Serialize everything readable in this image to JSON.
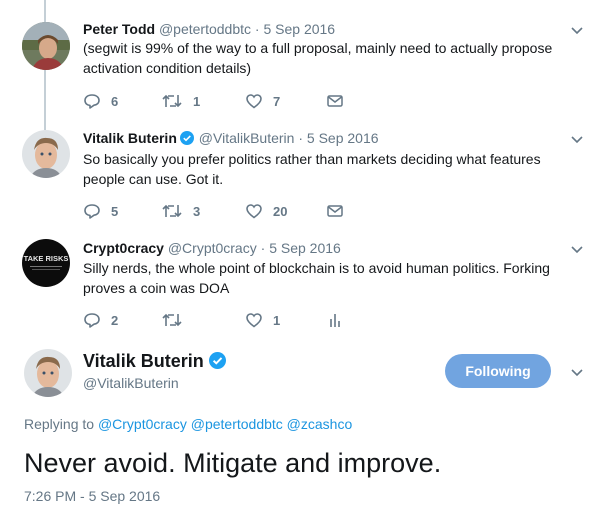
{
  "tweets": [
    {
      "name": "Peter Todd",
      "handle": "@petertoddbtc",
      "sep": " · ",
      "date": "5 Sep 2016",
      "text": "(segwit is 99% of the way to a full proposal, mainly need to actually propose activation condition details)",
      "reply_count": "6",
      "retweet_count": "1",
      "like_count": "7"
    },
    {
      "name": "Vitalik Buterin",
      "handle": "@VitalikButerin",
      "sep": " · ",
      "date": "5 Sep 2016",
      "text": "So basically you prefer politics rather than markets deciding what features people can use. Got it.",
      "reply_count": "5",
      "retweet_count": "3",
      "like_count": "20"
    },
    {
      "name": "Crypt0cracy",
      "handle": "@Crypt0cracy",
      "sep": " · ",
      "date": "5 Sep 2016",
      "text": "Silly nerds, the whole point of blockchain is to avoid human politics. Forking proves a coin was DOA",
      "reply_count": "2",
      "retweet_count": "",
      "like_count": "1",
      "avatar_text": "TAKE RISKS"
    }
  ],
  "main": {
    "name": "Vitalik Buterin",
    "handle": "@VitalikButerin",
    "follow_label": "Following",
    "replying_prefix": "Replying to",
    "mentions": [
      "@Crypt0cracy",
      "@petertoddbtc",
      "@zcashco"
    ],
    "text": "Never avoid. Mitigate and improve.",
    "timestamp": "7:26 PM - 5 Sep 2016"
  },
  "colors": {
    "accent": "#1da1f2",
    "follow_button": "#71a4e0",
    "muted_text": "#657786",
    "thread_line": "#c4cfd6"
  },
  "icons": [
    "reply-icon",
    "retweet-icon",
    "like-icon",
    "message-icon",
    "analytics-icon",
    "verified-icon",
    "chevron-down-icon"
  ]
}
